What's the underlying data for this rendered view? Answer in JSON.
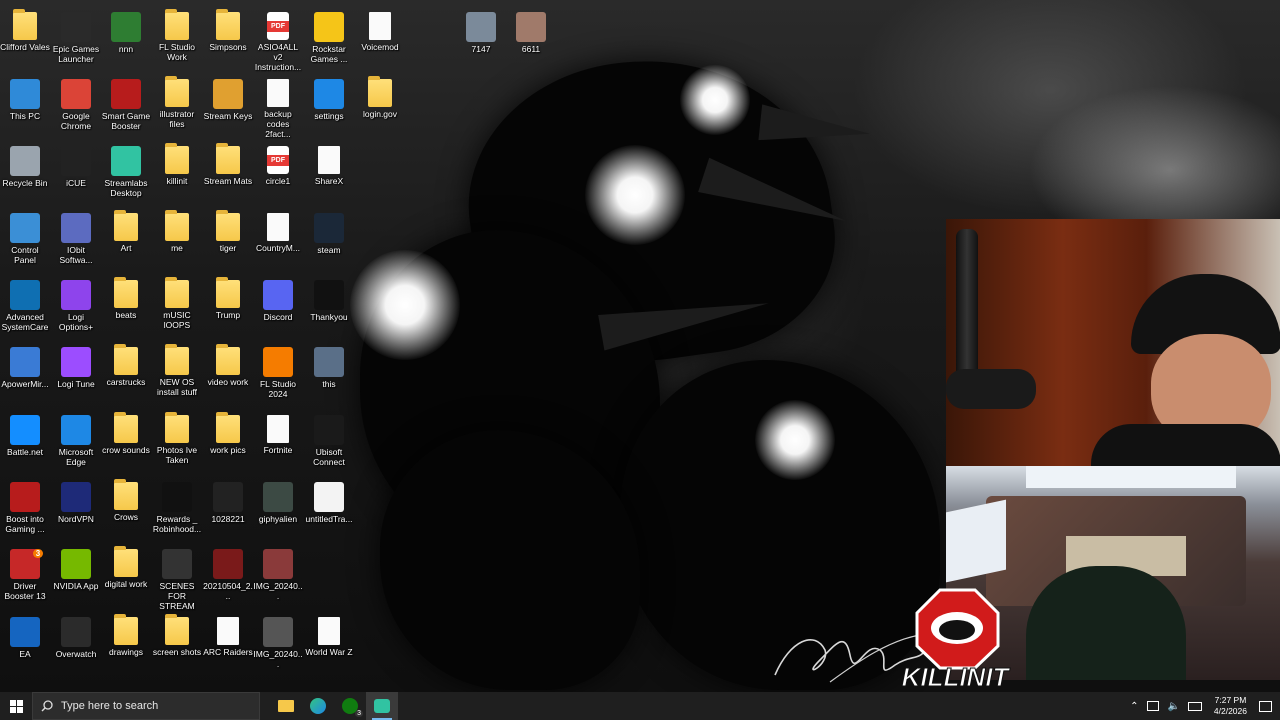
{
  "desktop": {
    "icons": [
      {
        "label": "Clifford Vales",
        "icon": "person-folder-icon",
        "kind": "folder"
      },
      {
        "label": "Epic Games Launcher",
        "icon": "epic-games-icon",
        "kind": "app",
        "color": "#2a2a2a"
      },
      {
        "label": "nnn",
        "icon": "monitor-icon",
        "kind": "app",
        "color": "#2e7d32"
      },
      {
        "label": "FL Studio Work",
        "icon": "folder-icon",
        "kind": "folder"
      },
      {
        "label": "Simpsons",
        "icon": "folder-icon",
        "kind": "folder"
      },
      {
        "label": "ASIO4ALL v2 Instruction...",
        "icon": "pdf-icon",
        "kind": "pdf"
      },
      {
        "label": "Rockstar Games ...",
        "icon": "rockstar-icon",
        "kind": "app",
        "color": "#f5c518"
      },
      {
        "label": "Voicemod",
        "icon": "document-icon",
        "kind": "doc"
      },
      {
        "label": "This PC",
        "icon": "computer-icon",
        "kind": "app",
        "color": "#2f8ad8"
      },
      {
        "label": "Google Chrome",
        "icon": "chrome-icon",
        "kind": "app",
        "color": "#db4437"
      },
      {
        "label": "Smart Game Booster",
        "icon": "game-booster-icon",
        "kind": "app",
        "color": "#b71c1c"
      },
      {
        "label": "illustrator files",
        "icon": "folder-icon",
        "kind": "folder"
      },
      {
        "label": "Stream Keys",
        "icon": "key-icon",
        "kind": "app",
        "color": "#e0a030"
      },
      {
        "label": "backup codes 2fact...",
        "icon": "document-icon",
        "kind": "doc"
      },
      {
        "label": "settings",
        "icon": "edge-icon",
        "kind": "app",
        "color": "#1e88e5"
      },
      {
        "label": "login.gov",
        "icon": "folder-icon",
        "kind": "folder"
      },
      {
        "label": "Recycle Bin",
        "icon": "recycle-bin-icon",
        "kind": "app",
        "color": "#9aa4ae"
      },
      {
        "label": "iCUE",
        "icon": "icue-icon",
        "kind": "app",
        "color": "#222"
      },
      {
        "label": "Streamlabs Desktop",
        "icon": "streamlabs-icon",
        "kind": "app",
        "color": "#31c3a2"
      },
      {
        "label": "killinit",
        "icon": "folder-icon",
        "kind": "folder"
      },
      {
        "label": "Stream Mats",
        "icon": "folder-icon",
        "kind": "folder"
      },
      {
        "label": "circle1",
        "icon": "pdf-icon",
        "kind": "pdf"
      },
      {
        "label": "ShareX",
        "icon": "document-icon",
        "kind": "doc"
      },
      {
        "label": "Control Panel",
        "icon": "control-panel-icon",
        "kind": "app",
        "color": "#3b8fd6"
      },
      {
        "label": "IObit Softwa...",
        "icon": "iobit-icon",
        "kind": "app",
        "color": "#5c6bc0"
      },
      {
        "label": "Art",
        "icon": "folder-icon",
        "kind": "folder"
      },
      {
        "label": "me",
        "icon": "folder-icon",
        "kind": "folder"
      },
      {
        "label": "tiger",
        "icon": "folder-icon",
        "kind": "folder"
      },
      {
        "label": "CountryM...",
        "icon": "document-icon",
        "kind": "doc"
      },
      {
        "label": "steam",
        "icon": "steam-icon",
        "kind": "app",
        "color": "#1b2838"
      },
      {
        "label": "Advanced SystemCare",
        "icon": "systemcare-icon",
        "kind": "app",
        "color": "#0f6fb2"
      },
      {
        "label": "Logi Options+",
        "icon": "logi-icon",
        "kind": "app",
        "color": "#8e44ec"
      },
      {
        "label": "beats",
        "icon": "folder-icon",
        "kind": "folder"
      },
      {
        "label": "mUSIC lOOPS",
        "icon": "folder-icon",
        "kind": "folder"
      },
      {
        "label": "Trump",
        "icon": "folder-icon",
        "kind": "folder"
      },
      {
        "label": "Discord",
        "icon": "discord-icon",
        "kind": "app",
        "color": "#5865f2"
      },
      {
        "label": "Thankyou",
        "icon": "thankyou-icon",
        "kind": "app",
        "color": "#111"
      },
      {
        "label": "ApowerMir...",
        "icon": "apowermirror-icon",
        "kind": "app",
        "color": "#3a7bd5"
      },
      {
        "label": "Logi Tune",
        "icon": "logi-tune-icon",
        "kind": "app",
        "color": "#9c4dff"
      },
      {
        "label": "carstrucks",
        "icon": "folder-icon",
        "kind": "folder"
      },
      {
        "label": "NEW OS install stuff",
        "icon": "folder-icon",
        "kind": "folder"
      },
      {
        "label": "video work",
        "icon": "folder-icon",
        "kind": "folder"
      },
      {
        "label": "FL Studio 2024",
        "icon": "fl-studio-icon",
        "kind": "app",
        "color": "#f57c00"
      },
      {
        "label": "this",
        "icon": "image-icon",
        "kind": "app",
        "color": "#5a6f88"
      },
      {
        "label": "Battle.net",
        "icon": "battlenet-icon",
        "kind": "app",
        "color": "#148eff"
      },
      {
        "label": "Microsoft Edge",
        "icon": "edge-icon",
        "kind": "app",
        "color": "#1e88e5"
      },
      {
        "label": "crow sounds",
        "icon": "folder-icon",
        "kind": "folder"
      },
      {
        "label": "Photos Ive Taken",
        "icon": "folder-icon",
        "kind": "folder"
      },
      {
        "label": "work pics",
        "icon": "folder-icon",
        "kind": "folder"
      },
      {
        "label": "Fortnite",
        "icon": "document-icon",
        "kind": "doc"
      },
      {
        "label": "Ubisoft Connect",
        "icon": "ubisoft-icon",
        "kind": "app",
        "color": "#1a1a1a"
      },
      {
        "label": "Boost into Gaming ...",
        "icon": "game-booster-icon",
        "kind": "app",
        "color": "#b71c1c"
      },
      {
        "label": "NordVPN",
        "icon": "nordvpn-icon",
        "kind": "app",
        "color": "#1e2a78"
      },
      {
        "label": "Crows",
        "icon": "folder-icon",
        "kind": "folder"
      },
      {
        "label": "Rewards _ Robinhood...",
        "icon": "star-icon",
        "kind": "app",
        "color": "#111"
      },
      {
        "label": "1028221",
        "icon": "image-icon",
        "kind": "app",
        "color": "#222"
      },
      {
        "label": "giphyalien",
        "icon": "alien-icon",
        "kind": "app",
        "color": "#3c4a44"
      },
      {
        "label": "untitledTra...",
        "icon": "video-icon",
        "kind": "app",
        "color": "#f3f3f3"
      },
      {
        "label": "Driver Booster 13",
        "icon": "driver-booster-icon",
        "kind": "app",
        "color": "#c62828"
      },
      {
        "label": "NVIDIA App",
        "icon": "nvidia-icon",
        "kind": "app",
        "color": "#76b900"
      },
      {
        "label": "digital work",
        "icon": "folder-icon",
        "kind": "folder"
      },
      {
        "label": "SCENES FOR STREAM",
        "icon": "scenes-icon",
        "kind": "app",
        "color": "#333"
      },
      {
        "label": "20210504_2...",
        "icon": "image-icon",
        "kind": "app",
        "color": "#7a1a1a"
      },
      {
        "label": "IMG_20240...",
        "icon": "image-icon",
        "kind": "app",
        "color": "#8a3a3a"
      },
      {
        "label": "EA",
        "icon": "ea-icon",
        "kind": "app",
        "color": "#1565c0"
      },
      {
        "label": "Overwatch",
        "icon": "overwatch-icon",
        "kind": "app",
        "color": "#2b2b2b"
      },
      {
        "label": "drawings",
        "icon": "folder-icon",
        "kind": "folder"
      },
      {
        "label": "screen shots",
        "icon": "folder-icon",
        "kind": "folder"
      },
      {
        "label": "ARC Raiders",
        "icon": "document-icon",
        "kind": "doc"
      },
      {
        "label": "IMG_20240...",
        "icon": "image-icon",
        "kind": "app",
        "color": "#555"
      },
      {
        "label": "World War Z",
        "icon": "document-icon",
        "kind": "doc"
      },
      {
        "label": "7147",
        "icon": "image-icon",
        "kind": "app",
        "color": "#7b8a9a"
      },
      {
        "label": "6611",
        "icon": "photo-icon",
        "kind": "app",
        "color": "#a07a6a"
      }
    ]
  },
  "overlay": {
    "logo_text": "KILLINIT"
  },
  "taskbar": {
    "search_placeholder": "Type here to search",
    "time": "7:27 PM",
    "date": "4/2/2026",
    "xbox_badge": "3"
  },
  "driver_booster_badge": "3"
}
